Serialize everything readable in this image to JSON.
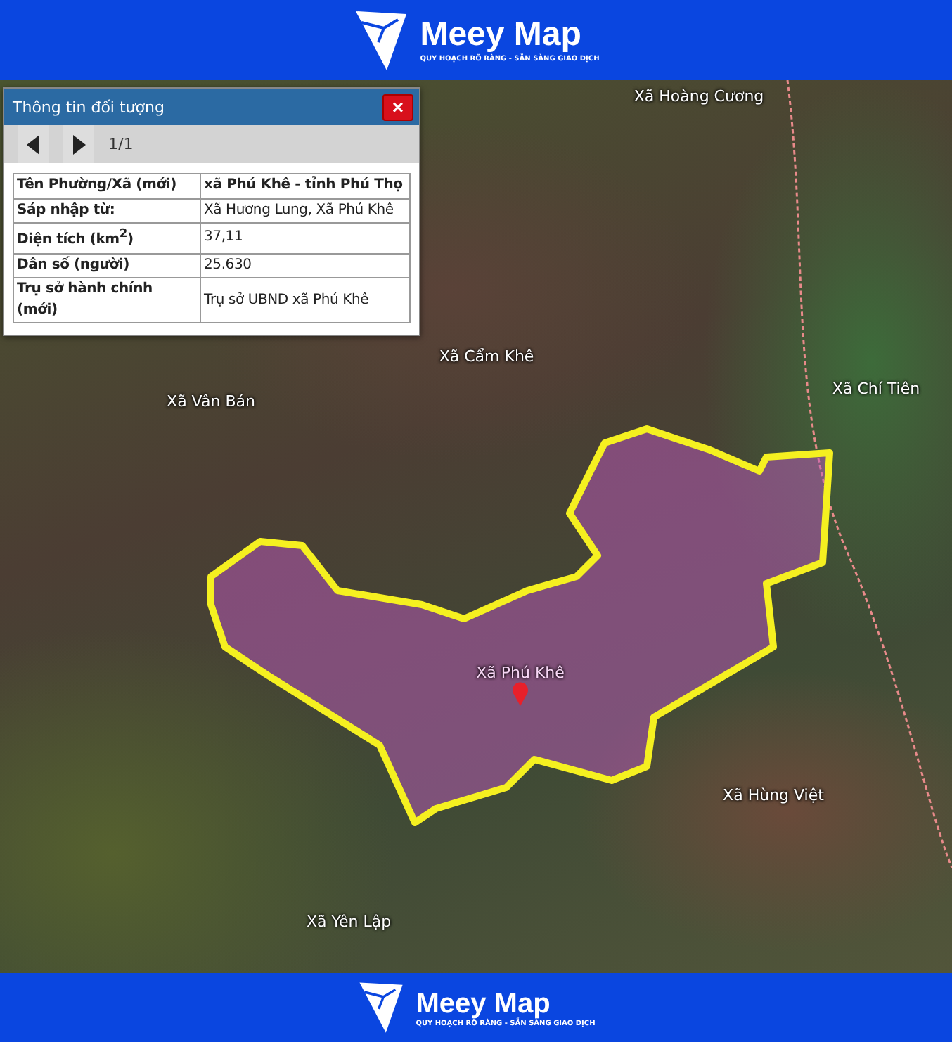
{
  "header": {
    "brand": "Meey Map",
    "tagline": "QUY HOẠCH RÕ RÀNG - SẴN SÀNG GIAO DỊCH"
  },
  "map": {
    "labels": [
      {
        "text": "Xã Hoàng Cương",
        "kind": "commune"
      },
      {
        "text": "Xã Cẩm Khê",
        "kind": "commune"
      },
      {
        "text": "Xã Chí Tiên",
        "kind": "commune"
      },
      {
        "text": "Xã Vân Bán",
        "kind": "commune"
      },
      {
        "text": "Xã Phú Khê",
        "kind": "selected"
      },
      {
        "text": "Xã Hùng Việt",
        "kind": "commune"
      },
      {
        "text": "Xã Yên Lập",
        "kind": "commune"
      }
    ]
  },
  "popup": {
    "title": "Thông tin đối tượng",
    "close": "×",
    "pager": "1/1",
    "rows": [
      {
        "label": "Tên Phường/Xã (mới)",
        "value": "xã Phú Khê - tỉnh Phú Thọ",
        "kind": "heading"
      },
      {
        "label": "Sáp nhập từ:",
        "value": "Xã Hương Lung, Xã Phú Khê",
        "kind": "plain"
      },
      {
        "label": "Diện tích (km$^{2}$)",
        "value": "37,11",
        "kind": "plain"
      },
      {
        "label": "Dân số (người)",
        "value": "25.630",
        "kind": "plain"
      },
      {
        "label": "Trụ sở hành chính (mới)",
        "value": "Trụ sở UBND xã Phú Khê",
        "kind": "plain"
      }
    ]
  },
  "footer": {
    "brand": "Meey Map",
    "tagline": "QUY HOẠCH RÕ RÀNG - SẴN SÀNG GIAO DỊCH"
  }
}
